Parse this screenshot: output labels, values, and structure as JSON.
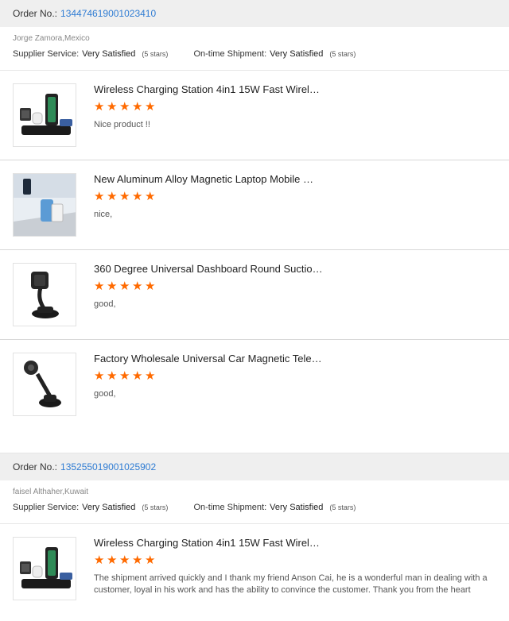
{
  "orders": [
    {
      "order_label": "Order No.:",
      "order_number": "134474619001023410",
      "buyer": "Jorge Zamora,Mexico",
      "supplier_label": "Supplier Service:",
      "supplier_value": "Very Satisfied",
      "supplier_stars": "(5 stars)",
      "shipment_label": "On-time Shipment:",
      "shipment_value": "Very Satisfied",
      "shipment_stars": "(5 stars)",
      "items": [
        {
          "title": "Wireless Charging Station 4in1 15W Fast Wirel…",
          "rating": 5,
          "comment": "Nice product !!",
          "image": "charging-station"
        },
        {
          "title": "New Aluminum Alloy Magnetic Laptop Mobile …",
          "rating": 5,
          "comment": "nice,",
          "image": "laptop-holder"
        },
        {
          "title": "360 Degree Universal Dashboard Round Suctio…",
          "rating": 5,
          "comment": "good,",
          "image": "dashboard-mount"
        },
        {
          "title": "Factory Wholesale Universal Car Magnetic Tele…",
          "rating": 5,
          "comment": "good,",
          "image": "telescopic-mount"
        }
      ]
    },
    {
      "order_label": "Order No.:",
      "order_number": "135255019001025902",
      "buyer": "faisel Althaher,Kuwait",
      "supplier_label": "Supplier Service:",
      "supplier_value": "Very Satisfied",
      "supplier_stars": "(5 stars)",
      "shipment_label": "On-time Shipment:",
      "shipment_value": "Very Satisfied",
      "shipment_stars": "(5 stars)",
      "items": [
        {
          "title": "Wireless Charging Station 4in1 15W Fast Wirel…",
          "rating": 5,
          "comment": "The shipment arrived quickly and I thank my friend Anson Cai, he is a wonderful man in dealing with a customer, loyal in his work and has the ability to convince the customer. Thank you from the heart",
          "image": "charging-station"
        }
      ]
    }
  ],
  "colors": {
    "link": "#2f7cd3",
    "star": "#ff6a00",
    "header_bg": "#efefef"
  }
}
